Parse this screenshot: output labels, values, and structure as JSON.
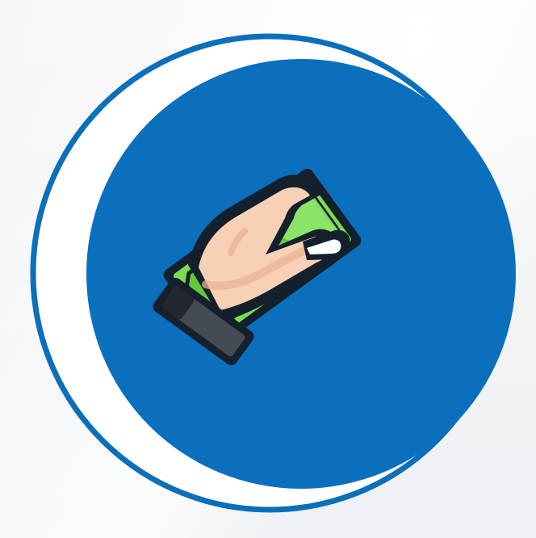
{
  "icon": {
    "name": "hand-holding-money-icon",
    "colors": {
      "background": "#f3f4f6",
      "ring": "#0b6fba",
      "inner_circle": "#0a6fbc",
      "white_gap": "#ffffff",
      "bill": "#7bdc53",
      "bill_dark": "#4fae35",
      "bill_outline": "#14202b",
      "coin": "#f3ead6",
      "hand": "#f7d0b6",
      "hand_shadow": "#e8b394",
      "cuff": "#444b52",
      "cuff_dark": "#23282d"
    }
  }
}
